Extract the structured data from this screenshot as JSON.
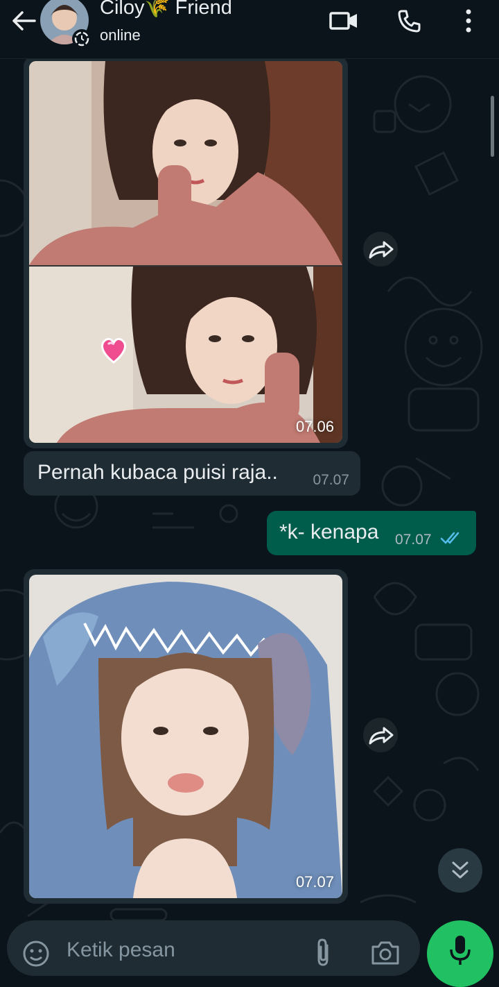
{
  "header": {
    "contact_name": "Ciloy🌾 Friend",
    "status": "online",
    "icons": [
      "back-arrow-icon",
      "video-call-icon",
      "phone-call-icon",
      "more-options-icon"
    ]
  },
  "messages": [
    {
      "type": "image",
      "direction": "incoming",
      "time": "07.06",
      "description_icon": "heart-sticker-icon"
    },
    {
      "type": "text",
      "direction": "incoming",
      "text": "Pernah kubaca puisi raja..",
      "time": "07.07"
    },
    {
      "type": "text",
      "direction": "outgoing",
      "text": "*k- kenapa",
      "time": "07.07",
      "status": "read"
    },
    {
      "type": "image",
      "direction": "incoming",
      "time": "07.07"
    }
  ],
  "composer": {
    "placeholder": "Ketik pesan"
  },
  "colors": {
    "background": "#0b141a",
    "incoming_bubble": "#202c33",
    "outgoing_bubble": "#005c4b",
    "read_ticks": "#53bdeb",
    "mic_button": "#21c063"
  }
}
